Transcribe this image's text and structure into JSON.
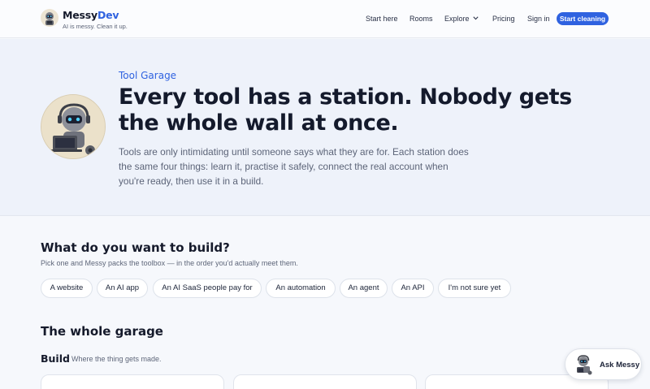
{
  "header": {
    "brand_prefix": "Messy",
    "brand_accent": "Dev",
    "tagline": "AI is messy. Clean it up.",
    "nav": [
      {
        "label": "Start here"
      },
      {
        "label": "Rooms"
      },
      {
        "label": "Explore",
        "icon": "chevron-down-icon"
      },
      {
        "label": "Pricing"
      },
      {
        "label": "Sign in"
      }
    ],
    "cta_label": "Start cleaning"
  },
  "hero": {
    "eyebrow": "Tool Garage",
    "title": "Every tool has a station. Nobody gets the whole wall at once.",
    "description": "Tools are only intimidating until someone says what they are for. Each station does the same four things: learn it, practise it safely, connect the real account when you're ready, then use it in a build."
  },
  "build_picker": {
    "title": "What do you want to build?",
    "subtitle": "Pick one and Messy packs the toolbox — in the order you'd actually meet them.",
    "options": [
      "A website",
      "An AI app",
      "An AI SaaS people pay for",
      "An automation",
      "An agent",
      "An API",
      "I'm not sure yet"
    ]
  },
  "garage": {
    "title": "The whole garage",
    "section_label": "Build",
    "section_sub": "Where the thing gets made."
  },
  "assistant": {
    "label": "Ask Messy"
  },
  "colors": {
    "accent": "#2f62e0",
    "hero_bg": "#eef2fa",
    "page_bg": "#f6f8fc"
  }
}
